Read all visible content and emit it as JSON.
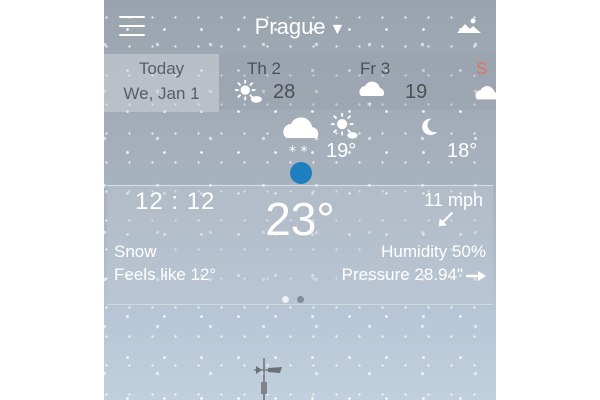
{
  "header": {
    "city": "Prague",
    "caret": "▼"
  },
  "icons": {
    "menu": "menu-icon",
    "mountains": "mountains-icon",
    "sun": "sun-icon",
    "cloud": "cloud-icon",
    "moon": "moon-icon"
  },
  "strip": {
    "today_label": "Today",
    "today_date": "We, Jan 1",
    "days": [
      {
        "name": "Th 2",
        "temp": "28"
      },
      {
        "name": "Fr 3",
        "temp": "19"
      },
      {
        "name": "S",
        "temp": ""
      }
    ]
  },
  "hourly": {
    "temp_1": "19°",
    "temp_2": "18°"
  },
  "current": {
    "time": "12 : 12",
    "temperature": "23°",
    "wind": "11 mph",
    "condition": "Snow",
    "feels_like": "Feels like 12°",
    "humidity": "Humidity 50%",
    "pressure": "Pressure 28.94\""
  },
  "pager": {
    "pages": 2,
    "active": 1
  },
  "colors": {
    "dot": "#1e7fbf",
    "day_text": "#4b5057",
    "weekend": "#e0735a"
  }
}
